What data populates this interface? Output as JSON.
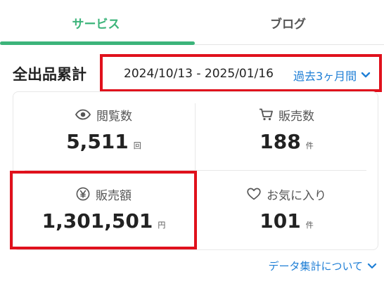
{
  "tabs": [
    {
      "label": "サービス",
      "active": true
    },
    {
      "label": "ブログ",
      "active": false
    }
  ],
  "summary": {
    "title": "全出品累計",
    "date_range": "2024/10/13 - 2025/01/16",
    "period_label": "過去3ヶ月間"
  },
  "stats": {
    "views": {
      "label": "閲覧数",
      "value": "5,511",
      "unit": "回",
      "icon": "eye-icon"
    },
    "sales": {
      "label": "販売数",
      "value": "188",
      "unit": "件",
      "icon": "cart-icon"
    },
    "revenue": {
      "label": "販売額",
      "value": "1,301,501",
      "unit": "円",
      "icon": "yen-icon"
    },
    "favorites": {
      "label": "お気に入り",
      "value": "101",
      "unit": "件",
      "icon": "heart-icon"
    }
  },
  "footer": {
    "link_label": "データ集計について"
  },
  "colors": {
    "accent_green": "#3cb47a",
    "link_blue": "#1f7fd6",
    "highlight_red": "#e0111c"
  }
}
